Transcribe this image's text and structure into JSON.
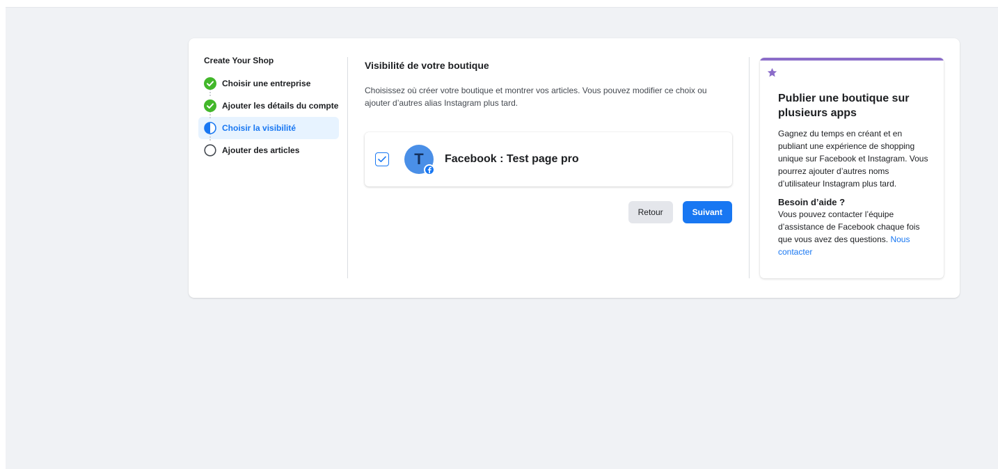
{
  "stepper": {
    "title": "Create Your Shop",
    "steps": [
      {
        "label": "Choisir une entreprise",
        "state": "completed"
      },
      {
        "label": "Ajouter les détails du compte",
        "state": "completed"
      },
      {
        "label": "Choisir la visibilité",
        "state": "current"
      },
      {
        "label": "Ajouter des articles",
        "state": "pending"
      }
    ]
  },
  "main": {
    "title": "Visibilité de votre boutique",
    "description": "Choisissez où créer votre boutique et montrer vos articles. Vous pouvez modifier ce choix ou ajouter d’autres alias Instagram plus tard.",
    "account": {
      "avatar_letter": "T",
      "name": "Facebook : Test page pro",
      "checked": true
    },
    "back_label": "Retour",
    "next_label": "Suivant"
  },
  "info": {
    "title": "Publier une boutique sur plusieurs apps",
    "text": "Gagnez du temps en créant et en publiant une expérience de shopping unique sur Facebook et Instagram. Vous pourrez ajouter d’autres noms d’utilisateur Instagram plus tard.",
    "help_title": "Besoin d’aide ?",
    "help_text": "Vous pouvez contacter l’équipe d’assistance de Facebook chaque fois que vous avez des questions.",
    "help_link": "Nous contacter"
  },
  "colors": {
    "accent": "#1877f2",
    "success": "#42b72a",
    "info_bar": "#8b6cc9",
    "page_bg": "#f0f2f5"
  },
  "icons": {
    "completed": "check-circle-icon",
    "current": "half-circle-icon",
    "pending": "empty-circle-icon",
    "info": "star-icon",
    "badge": "facebook-icon"
  }
}
